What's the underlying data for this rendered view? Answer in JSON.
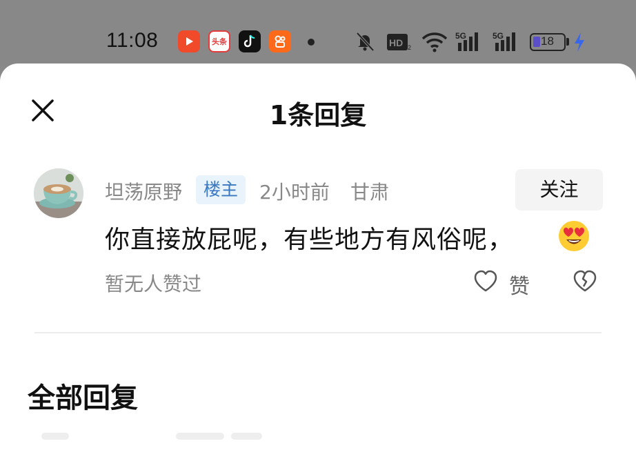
{
  "status_bar": {
    "time": "11:08",
    "app_icons": [
      {
        "name": "video-app-icon",
        "label": "▶",
        "color": "#f04a2a"
      },
      {
        "name": "toutiao-app-icon",
        "label": "头条",
        "color": "#e43c3c"
      },
      {
        "name": "tiktok-app-icon",
        "label": "♪",
        "color": "#111111"
      },
      {
        "name": "kuaishou-app-icon",
        "label": "⬤",
        "color": "#ff6a1a"
      }
    ],
    "battery_level": "18",
    "battery_accent": "#5b4ec9",
    "charging_color": "#3a66e8"
  },
  "sheet": {
    "title": "1条回复",
    "comment": {
      "user_name": "坦荡原野",
      "op_badge": "楼主",
      "time_ago": "2小时前",
      "location": "甘肃",
      "follow_label": "关注",
      "text": "你直接放屁呢，有些地方有风俗呢，",
      "emoji": "heart-eyes-emoji",
      "no_likes": "暂无人赞过",
      "like_label": "赞"
    },
    "section_title": "全部回复"
  },
  "colors": {
    "badge_bg": "#e8f3fb",
    "badge_text": "#3a78c2",
    "muted_text": "#888888"
  }
}
